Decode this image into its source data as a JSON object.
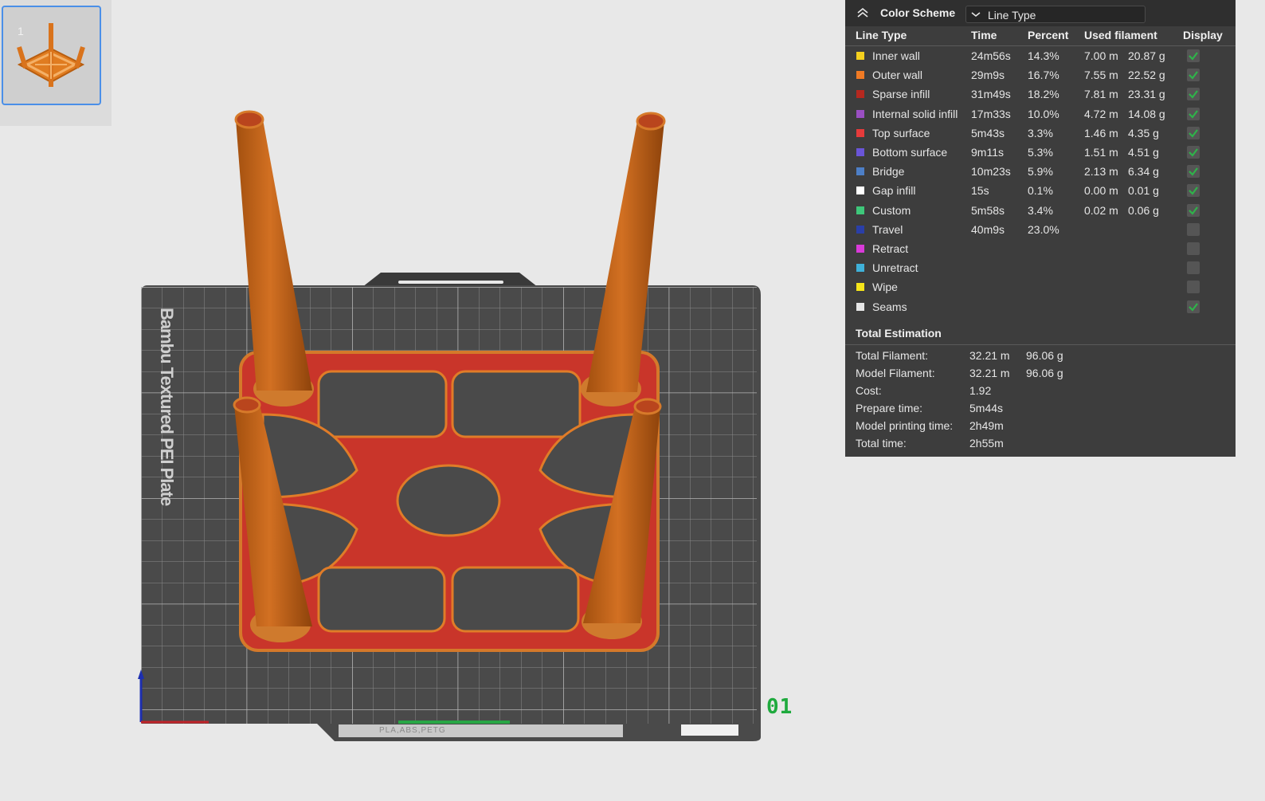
{
  "thumbnail": {
    "plate_index": "1"
  },
  "scene": {
    "plate_label": "Bambu Textured PEI Plate",
    "plate_number": "01",
    "plate_bar_text": "PLA,ABS,PETG"
  },
  "color_scheme": {
    "label": "Color Scheme",
    "selected": "Line Type"
  },
  "columns": {
    "line_type": "Line Type",
    "time": "Time",
    "percent": "Percent",
    "used_filament": "Used filament",
    "display": "Display"
  },
  "rows": [
    {
      "name": "Inner wall",
      "color": "#f5d01e",
      "time": "24m56s",
      "percent": "14.3%",
      "length": "7.00 m",
      "weight": "20.87 g",
      "display": true
    },
    {
      "name": "Outer wall",
      "color": "#f07a24",
      "time": "29m9s",
      "percent": "16.7%",
      "length": "7.55 m",
      "weight": "22.52 g",
      "display": true
    },
    {
      "name": "Sparse infill",
      "color": "#b5281f",
      "time": "31m49s",
      "percent": "18.2%",
      "length": "7.81 m",
      "weight": "23.31 g",
      "display": true
    },
    {
      "name": "Internal solid infill",
      "color": "#9a4fc2",
      "time": "17m33s",
      "percent": "10.0%",
      "length": "4.72 m",
      "weight": "14.08 g",
      "display": true
    },
    {
      "name": "Top surface",
      "color": "#e63b3b",
      "time": "5m43s",
      "percent": "3.3%",
      "length": "1.46 m",
      "weight": "4.35 g",
      "display": true
    },
    {
      "name": "Bottom surface",
      "color": "#6a55d8",
      "time": "9m11s",
      "percent": "5.3%",
      "length": "1.51 m",
      "weight": "4.51 g",
      "display": true
    },
    {
      "name": "Bridge",
      "color": "#4d7fc7",
      "time": "10m23s",
      "percent": "5.9%",
      "length": "2.13 m",
      "weight": "6.34 g",
      "display": true
    },
    {
      "name": "Gap infill",
      "color": "#ffffff",
      "time": "15s",
      "percent": "0.1%",
      "length": "0.00 m",
      "weight": "0.01 g",
      "display": true
    },
    {
      "name": "Custom",
      "color": "#3ec77a",
      "time": "5m58s",
      "percent": "3.4%",
      "length": "0.02 m",
      "weight": "0.06 g",
      "display": true
    },
    {
      "name": "Travel",
      "color": "#2a3fa8",
      "time": "40m9s",
      "percent": "23.0%",
      "length": "",
      "weight": "",
      "display": false
    },
    {
      "name": "Retract",
      "color": "#d93ad9",
      "time": "",
      "percent": "",
      "length": "",
      "weight": "",
      "display": false
    },
    {
      "name": "Unretract",
      "color": "#3fb1d9",
      "time": "",
      "percent": "",
      "length": "",
      "weight": "",
      "display": false
    },
    {
      "name": "Wipe",
      "color": "#f5e51a",
      "time": "",
      "percent": "",
      "length": "",
      "weight": "",
      "display": false
    },
    {
      "name": "Seams",
      "color": "#e6e6e6",
      "time": "",
      "percent": "",
      "length": "",
      "weight": "",
      "display": true
    }
  ],
  "total_estimation": {
    "title": "Total Estimation",
    "items": [
      {
        "label": "Total Filament:",
        "value": "32.21 m",
        "value2": "96.06 g"
      },
      {
        "label": "Model Filament:",
        "value": "32.21 m",
        "value2": "96.06 g"
      },
      {
        "label": "Cost:",
        "value": "1.92",
        "value2": ""
      },
      {
        "label": "Prepare time:",
        "value": "5m44s",
        "value2": ""
      },
      {
        "label": "Model printing time:",
        "value": "2h49m",
        "value2": ""
      },
      {
        "label": "Total time:",
        "value": "2h55m",
        "value2": ""
      }
    ]
  }
}
